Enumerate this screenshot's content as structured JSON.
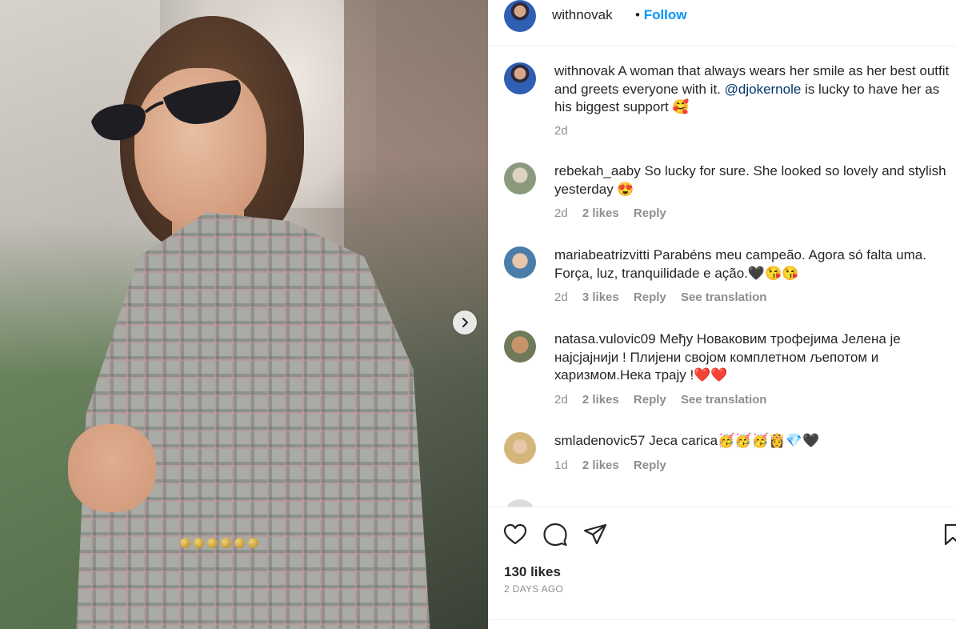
{
  "header": {
    "username": "withnovak",
    "dot": "•",
    "follow_label": "Follow"
  },
  "caption": {
    "username": "withnovak",
    "text_before": "A woman that always wears her smile as her best outfit and greets everyone with it. ",
    "mention": "@djokernole",
    "text_after": " is lucky to have her as his biggest support 🥰",
    "time": "2d"
  },
  "comments": [
    {
      "username": "rebekah_aaby",
      "text": "So lucky for sure. She looked so lovely and stylish yesterday 😍",
      "time": "2d",
      "likes": "2 likes",
      "reply": "Reply"
    },
    {
      "username": "mariabeatrizvitti",
      "text": "Parabéns meu campeão. Agora só falta uma. Força, luz, tranquilidade e ação.🖤😘😘",
      "time": "2d",
      "likes": "3 likes",
      "reply": "Reply",
      "translate": "See translation"
    },
    {
      "username": "natasa.vulovic09",
      "text": "Међу Новаковим трофејима Јелена је најсјајнији ! Плијени својом комплетном љепотом и харизмом.Нека трају !❤️❤️",
      "time": "2d",
      "likes": "2 likes",
      "reply": "Reply",
      "translate": "See translation"
    },
    {
      "username": "smladenovic57",
      "text": "Jeca carica🥳🥳🥳👸💎🖤",
      "time": "1d",
      "likes": "2 likes",
      "reply": "Reply"
    }
  ],
  "footer": {
    "likes": "130 likes",
    "post_time": "2 DAYS AGO"
  },
  "icons": {
    "like": "heart-icon",
    "comment": "comment-icon",
    "share": "share-icon",
    "save": "bookmark-icon",
    "next": "chevron-right-icon"
  }
}
